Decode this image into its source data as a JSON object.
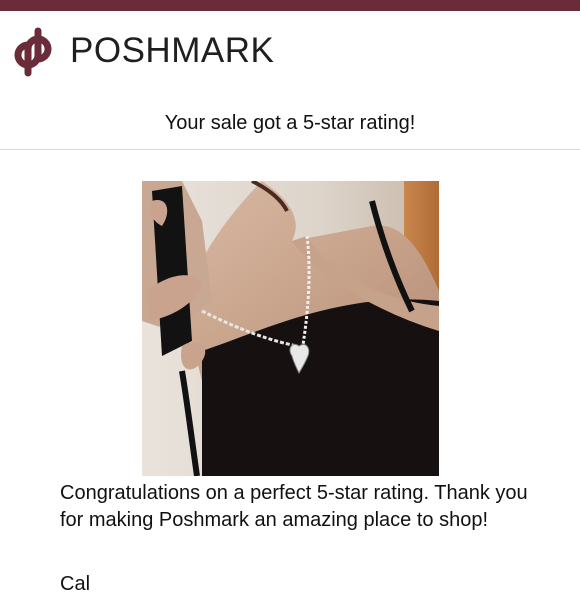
{
  "brand": {
    "name": "POSHMARK",
    "color": "#6b2c3a"
  },
  "email": {
    "subject_line": "Your sale got a 5-star rating!",
    "message": "Congratulations on a perfect 5-star rating. Thank you for making Poshmark an amazing place to shop!",
    "signoff": "Cal"
  },
  "product_image": {
    "icon": "necklace-photo"
  }
}
